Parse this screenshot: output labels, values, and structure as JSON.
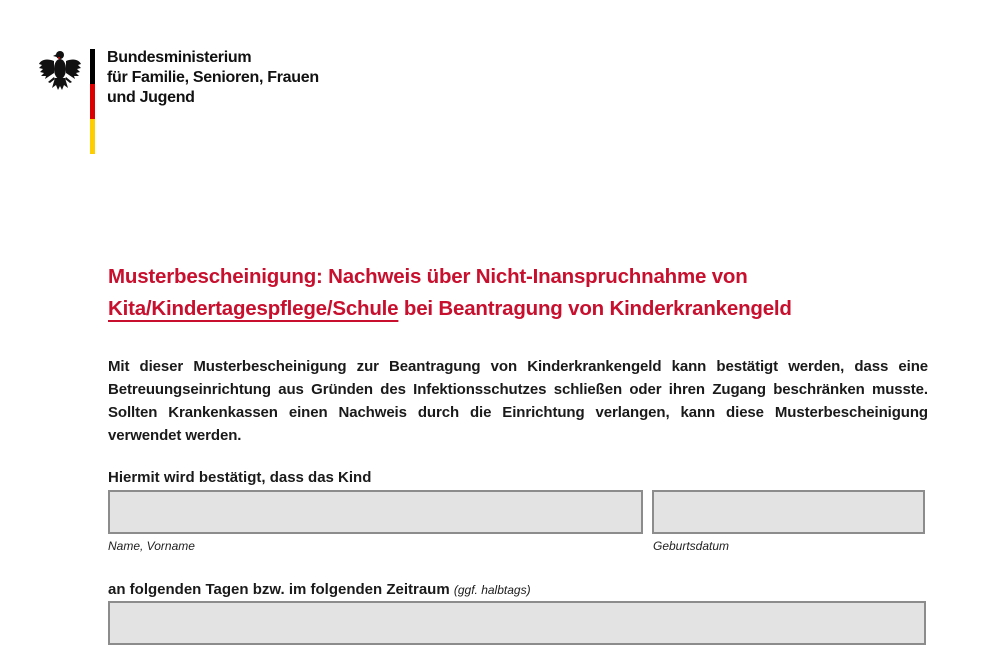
{
  "header": {
    "ministry_lines": [
      "Bundesministerium",
      "für Familie, Senioren, Frauen",
      "und Jugend"
    ],
    "emblem_icon": "federal-eagle-icon",
    "flag_colors": [
      "#000000",
      "#dd0000",
      "#ffce00"
    ]
  },
  "title": {
    "line1": "Musterbescheinigung: Nachweis über Nicht-Inanspruchnahme von",
    "line2_underlined": "Kita/Kindertagespflege/Schule",
    "line2_rest": " bei Beantragung von Kinderkrankengeld",
    "color": "#c8102e"
  },
  "intro": "Mit dieser Musterbescheinigung zur Beantragung von Kinderkrankengeld kann bestätigt werden, dass eine Betreuungseinrichtung aus Gründen des Infektionsschutzes schließen oder ihren Zugang beschrän­ken musste. Sollten Krankenkassen einen Nachweis durch die Einrichtung verlangen, kann diese Muster­bescheinigung verwendet werden.",
  "form": {
    "confirm_label": "Hiermit wird bestätigt, dass das Kind",
    "name_caption": "Name, Vorname",
    "birthdate_caption": "Geburtsdatum",
    "period_label": "an folgenden Tagen bzw. im folgenden Zeitraum",
    "period_hint": "(ggf. halbtags)",
    "field_fill": "#e3e3e3"
  }
}
